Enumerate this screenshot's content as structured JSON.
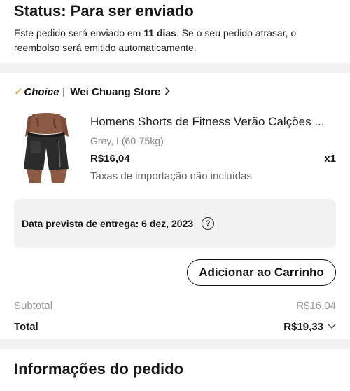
{
  "status": {
    "title": "Status: Para ser enviado",
    "message_pre": "Este pedido será enviado em ",
    "message_days": "11 dias",
    "message_post": ". Se o seu pedido atrasar, o reembolso será emitido automaticamente."
  },
  "store": {
    "badge": "Choice",
    "name": "Wei Chuang Store",
    "chevron_icon": "chevron-right-icon"
  },
  "product": {
    "title": "Homens Shorts de Fitness Verão Calções ...",
    "variant": "Grey, L(60-75kg)",
    "price": "R$16,04",
    "quantity": "x1",
    "tax_note": "Taxas de importação não incluídas"
  },
  "delivery": {
    "text": "Data prevista de entrega: 6 dez, 2023",
    "help_icon": "question-circle-icon",
    "help_glyph": "?"
  },
  "actions": {
    "add_to_cart": "Adicionar ao Carrinho"
  },
  "summary": {
    "subtotal_label": "Subtotal",
    "subtotal_value": "R$16,04",
    "total_label": "Total",
    "total_value": "R$19,33"
  },
  "info": {
    "title": "Informações do pedido"
  },
  "colors": {
    "choice_check": "#f5a623",
    "muted_text": "#999999",
    "box_bg": "#f2f2f2"
  }
}
